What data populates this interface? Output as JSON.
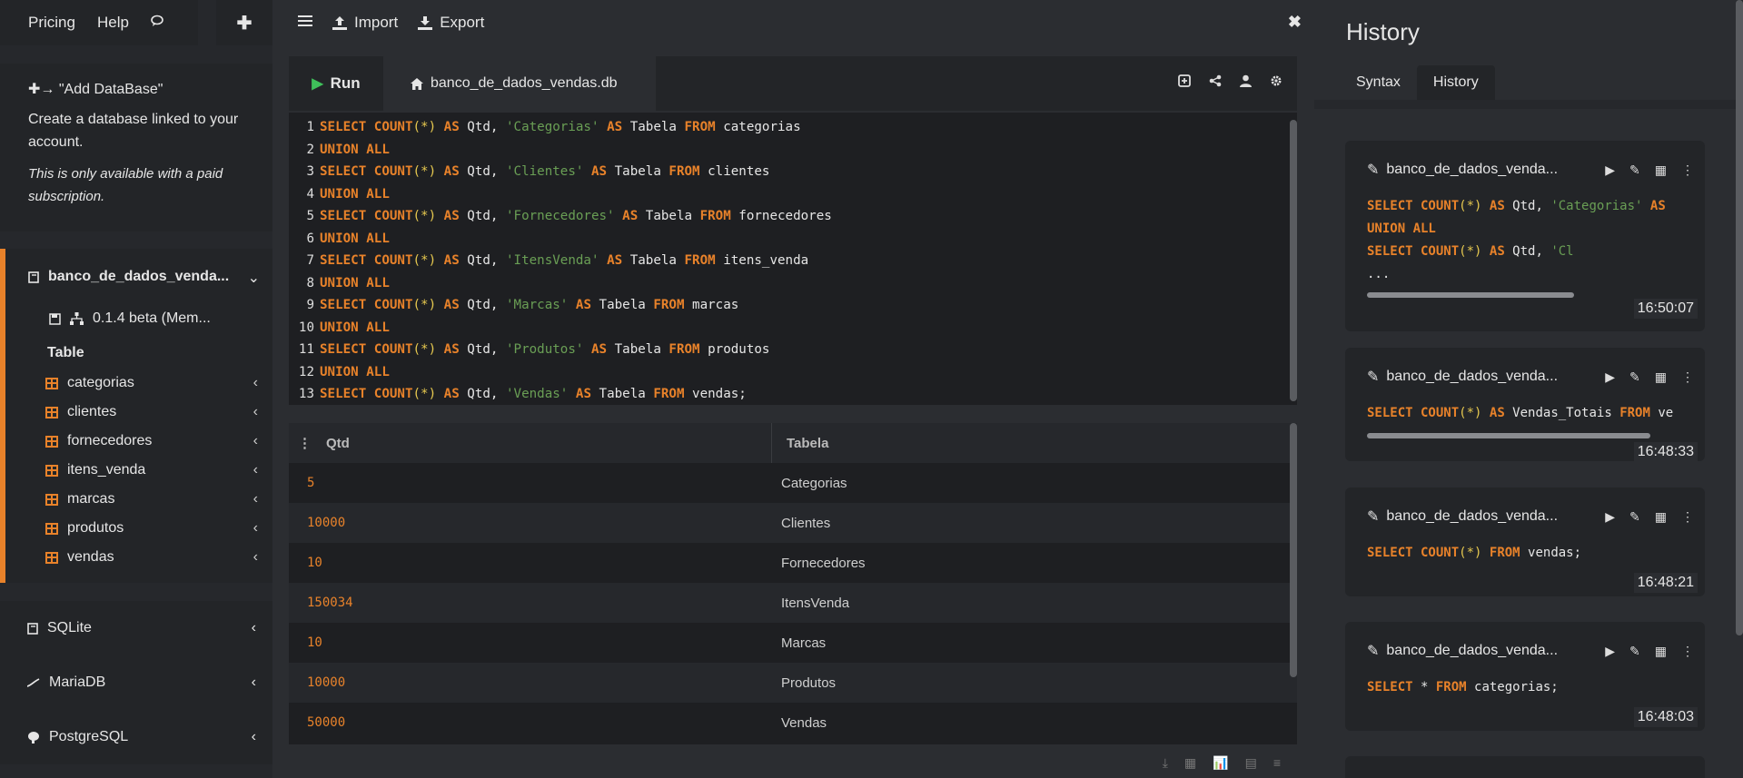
{
  "topnav": {
    "pricing": "Pricing",
    "help": "Help",
    "chat_icon": "chat-icon",
    "plus": "✚"
  },
  "add_db": {
    "title": "✚→ \"Add DataBase\"",
    "desc": "Create a database linked to your account.",
    "note": "This is only available with a paid subscription."
  },
  "db": {
    "name": "banco_de_dados_venda...",
    "version": "0.1.4 beta (Mem...",
    "table_header": "Table",
    "tables": [
      "categorias",
      "clientes",
      "fornecedores",
      "itens_venda",
      "marcas",
      "produtos",
      "vendas"
    ]
  },
  "engines": [
    "SQLite",
    "MariaDB",
    "PostgreSQL"
  ],
  "toolbar": {
    "import": "Import",
    "export": "Export",
    "close": "✖"
  },
  "tabs": {
    "run": "Run",
    "file": "banco_de_dados_vendas.db"
  },
  "editor": {
    "lines": [
      {
        "n": "1",
        "t": "Categorias",
        "f": "categorias"
      },
      {
        "n": "2",
        "u": true
      },
      {
        "n": "3",
        "t": "Clientes",
        "f": "clientes"
      },
      {
        "n": "4",
        "u": true
      },
      {
        "n": "5",
        "t": "Fornecedores",
        "f": "fornecedores"
      },
      {
        "n": "6",
        "u": true
      },
      {
        "n": "7",
        "t": "ItensVenda",
        "f": "itens_venda"
      },
      {
        "n": "8",
        "u": true
      },
      {
        "n": "9",
        "t": "Marcas",
        "f": "marcas"
      },
      {
        "n": "10",
        "u": true
      },
      {
        "n": "11",
        "t": "Produtos",
        "f": "produtos"
      },
      {
        "n": "12",
        "u": true
      },
      {
        "n": "13",
        "t": "Vendas",
        "f": "vendas",
        "semi": true
      }
    ]
  },
  "results": {
    "columns": [
      "Qtd",
      "Tabela"
    ],
    "rows": [
      [
        "5",
        "Categorias"
      ],
      [
        "10000",
        "Clientes"
      ],
      [
        "10",
        "Fornecedores"
      ],
      [
        "150034",
        "ItensVenda"
      ],
      [
        "10",
        "Marcas"
      ],
      [
        "10000",
        "Produtos"
      ],
      [
        "50000",
        "Vendas"
      ]
    ]
  },
  "history": {
    "title": "History",
    "tabs": [
      "Syntax",
      "History"
    ],
    "items": [
      {
        "name": "banco_de_dados_venda...",
        "time": "16:50:07"
      },
      {
        "name": "banco_de_dados_venda...",
        "time": "16:48:33"
      },
      {
        "name": "banco_de_dados_venda...",
        "time": "16:48:21"
      },
      {
        "name": "banco_de_dados_venda...",
        "time": "16:48:03"
      }
    ]
  },
  "colors": {
    "accent": "#e8822a",
    "run_green": "#3fc05a",
    "string_green": "#6a9f55"
  }
}
